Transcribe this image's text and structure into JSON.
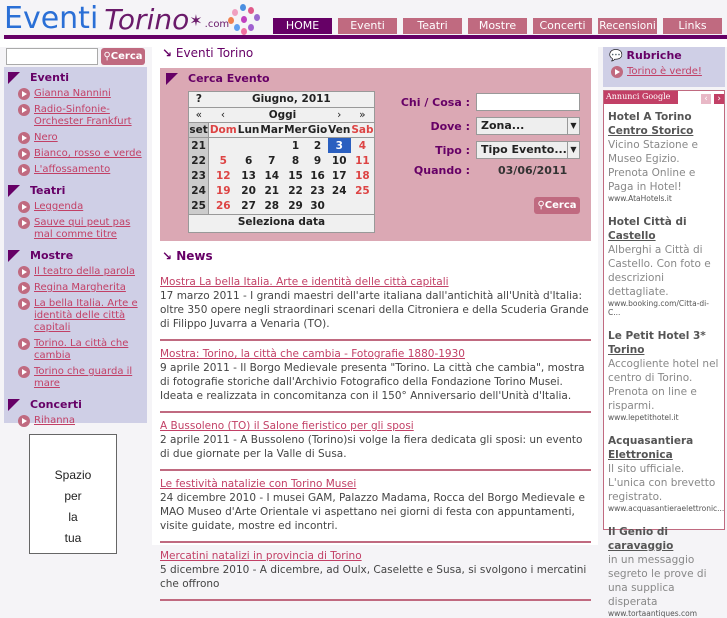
{
  "logo": {
    "text": "Eventi",
    "text2": "Torino",
    "suffix": ".com"
  },
  "nav": [
    "HOME",
    "Eventi",
    "Teatri",
    "Mostre",
    "Concerti",
    "Recensioni",
    "Links"
  ],
  "search": {
    "value": "",
    "button": "Cerca"
  },
  "sidebar": [
    {
      "title": "Eventi",
      "items": [
        "Gianna Nannini",
        "Radio-Sinfonie-Orchester Frankfurt",
        "Nero",
        "Bianco, rosso e verde",
        "L'affossamento"
      ]
    },
    {
      "title": "Teatri",
      "items": [
        "Leggenda",
        "Sauve qui peut pas mal comme titre"
      ]
    },
    {
      "title": "Mostre",
      "items": [
        "Il teatro della parola",
        "Regina Margherita",
        "La bella Italia. Arte e identità delle città capitali",
        "Torino. La città che cambia",
        "Torino che guarda il mare"
      ]
    },
    {
      "title": "Concerti",
      "items": [
        "Rihanna"
      ]
    }
  ],
  "ad_space": [
    "Spazio",
    "per",
    "la",
    "tua"
  ],
  "page_title": "Eventi Torino",
  "cerca": {
    "title": "Cerca Evento",
    "calendar": {
      "help": "?",
      "month": "Giugno, 2011",
      "prev_year": "«",
      "prev": "‹",
      "today": "Oggi",
      "next": "›",
      "next_year": "»",
      "headers": [
        "set",
        "Dom",
        "Lun",
        "Mar",
        "Mer",
        "Gio",
        "Ven",
        "Sab"
      ],
      "weeks": [
        [
          "21",
          "",
          "",
          "",
          "",
          "1",
          "2",
          "3",
          "4"
        ],
        [
          "22",
          "5",
          "6",
          "7",
          "8",
          "9",
          "10",
          "11"
        ],
        [
          "23",
          "12",
          "13",
          "14",
          "15",
          "16",
          "17",
          "18"
        ],
        [
          "24",
          "19",
          "20",
          "21",
          "22",
          "23",
          "24",
          "25"
        ],
        [
          "25",
          "26",
          "27",
          "28",
          "29",
          "30",
          "",
          ""
        ]
      ],
      "selected": "3",
      "footer": "Seleziona data"
    },
    "chi_label": "Chi / Cosa :",
    "chi_value": "",
    "dove_label": "Dove :",
    "dove_value": "Zona...",
    "tipo_label": "Tipo :",
    "tipo_value": "Tipo Evento...",
    "quando_label": "Quando :",
    "quando_value": "03/06/2011",
    "button": "Cerca"
  },
  "news": {
    "title": "News",
    "items": [
      {
        "title": "Mostra La bella Italia. Arte e identità delle città capitali",
        "text": "17 marzo 2011 - I grandi maestri dell'arte italiana dall'antichità all'Unità d'Italia: oltre 350 opere negli straordinari scenari della Citroniera e della Scuderia Grande di Filippo Juvarra a Venaria (TO)."
      },
      {
        "title": "Mostra: Torino, la città che cambia - Fotografie 1880-1930",
        "text": "9 aprile 2011 - Il Borgo Medievale presenta \"Torino. La città che cambia\", mostra di fotografie storiche dall'Archivio Fotografico della Fondazione Torino Musei. Ideata e realizzata in concomitanza con il 150° Anniversario dell'Unità d'Italia."
      },
      {
        "title": "A Bussoleno (TO) il Salone fieristico per gli sposi",
        "text": "2 aprile 2011 - A Bussoleno (Torino)si volge la fiera dedicata gli sposi: un evento di due giornate per la Valle di Susa."
      },
      {
        "title": "Le festività natalizie con Torino Musei",
        "text": "24 dicembre 2010 - I musei GAM, Palazzo Madama, Rocca del Borgo Medievale e MAO Museo d'Arte Orientale vi aspettano nei giorni di festa con appuntamenti, visite guidate, mostre ed incontri."
      },
      {
        "title": "Mercatini natalizi in provincia di Torino",
        "text": "5 dicembre 2010 - A dicembre, ad Oulx, Caselette e Susa, si svolgono i mercatini che offrono"
      }
    ]
  },
  "rubriche": {
    "title": "Rubriche",
    "items": [
      "Torino è verde!"
    ]
  },
  "google_ads": {
    "label": "Annunci Google",
    "items": [
      {
        "t1": "Hotel A Torino",
        "t2": "Centro Storico",
        "desc": "Vicino Stazione e Museo Egizio. Prenota Online e Paga in Hotel!",
        "url": "www.AtaHotels.it"
      },
      {
        "t1": "Hotel Città di",
        "t2": "Castello",
        "desc": "Alberghi a Città di Castello. Con foto e descrizioni dettagliate.",
        "url": "www.booking.com/Citta-di-C..."
      },
      {
        "t1": "Le Petit Hotel 3*",
        "t2": "Torino",
        "desc": "Accogliente hotel nel centro di Torino. Prenota on line e risparmi.",
        "url": "www.lepetithotel.it"
      },
      {
        "t1": "Acquasantiera",
        "t2": "Elettronica",
        "desc": "Il sito ufficiale. L'unica con brevetto registrato.",
        "url": "www.acquasantieraelettronic..."
      },
      {
        "t1": "Il Genio di",
        "t2": "caravaggio",
        "desc": "in un messaggio segreto le prove di una supplica disperata",
        "url": "www.tortaantiques.com"
      }
    ]
  },
  "colors": {
    "purple": "#660066",
    "pink": "#c06a80",
    "lavender": "#cfcfe6",
    "panel": "#dba8b4"
  }
}
